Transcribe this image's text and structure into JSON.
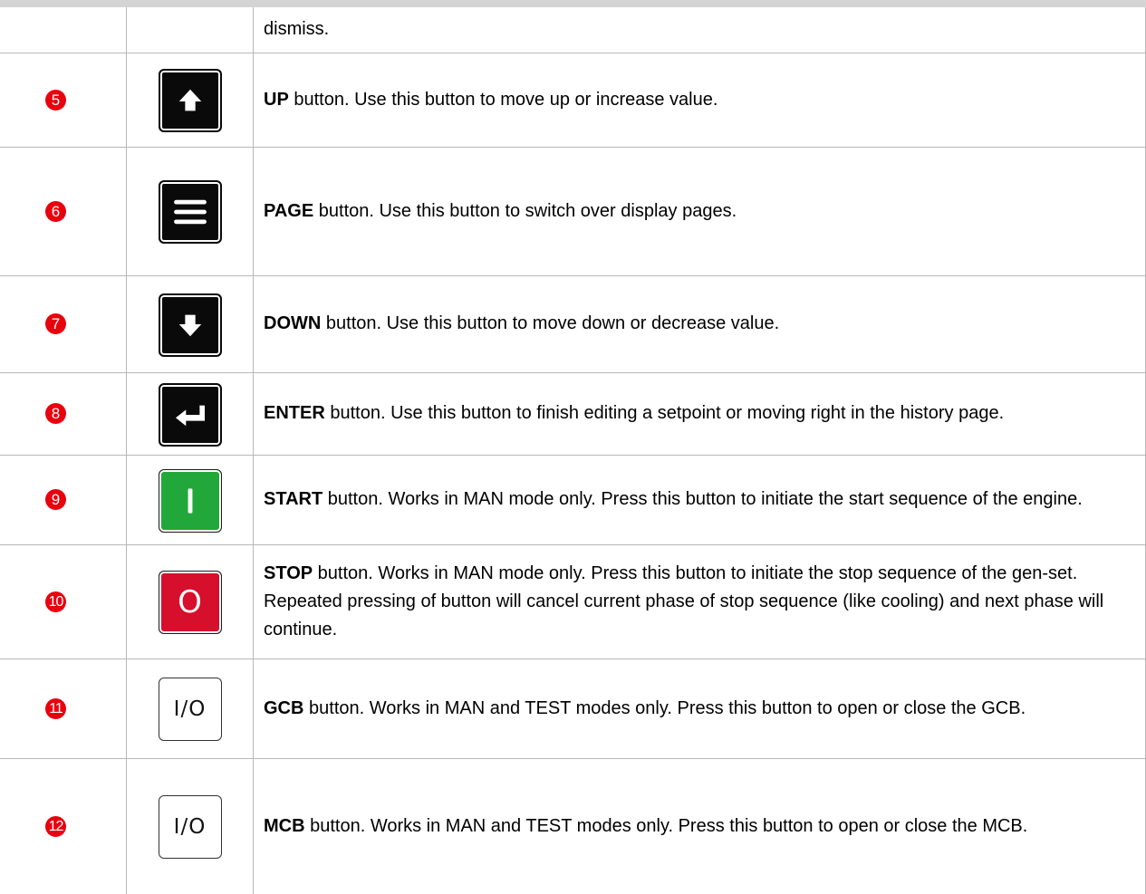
{
  "rows": [
    {
      "num": "",
      "icon": "",
      "title": "",
      "text": "dismiss."
    },
    {
      "num": "5",
      "icon": "up-arrow",
      "title": "UP",
      "text": " button. Use this button to move up or increase value."
    },
    {
      "num": "6",
      "icon": "page-menu",
      "title": "PAGE",
      "text": " button. Use this button to switch over display pages."
    },
    {
      "num": "7",
      "icon": "down-arrow",
      "title": "DOWN",
      "text": " button. Use this button to move down or decrease value."
    },
    {
      "num": "8",
      "icon": "enter-return",
      "title": "ENTER",
      "text": " button. Use this button to finish editing a setpoint or moving right in the history page."
    },
    {
      "num": "9",
      "icon": "start",
      "key_label": "|",
      "title": "START",
      "text": " button. Works in MAN mode only. Press this button to initiate the start sequence of the engine."
    },
    {
      "num": "10",
      "icon": "stop",
      "key_label": "O",
      "title": "STOP",
      "text": " button. Works in MAN mode only. Press this button to initiate the stop sequence of the gen-set. Repeated pressing of button will cancel current phase of stop sequence (like cooling) and next phase will continue."
    },
    {
      "num": "11",
      "icon": "gcb-io",
      "key_label": "I/O",
      "title": "GCB",
      "text": " button. Works in MAN and TEST modes only. Press this button to open or close the GCB."
    },
    {
      "num": "12",
      "icon": "mcb-io",
      "key_label": "I/O",
      "title": "MCB",
      "text": " button. Works in MAN and TEST modes only. Press this button to open or close the MCB."
    }
  ],
  "colors": {
    "badge": "#e8000e",
    "key_dark": "#0a0a0a",
    "key_start": "#22a83a",
    "key_stop": "#d60f2c"
  }
}
